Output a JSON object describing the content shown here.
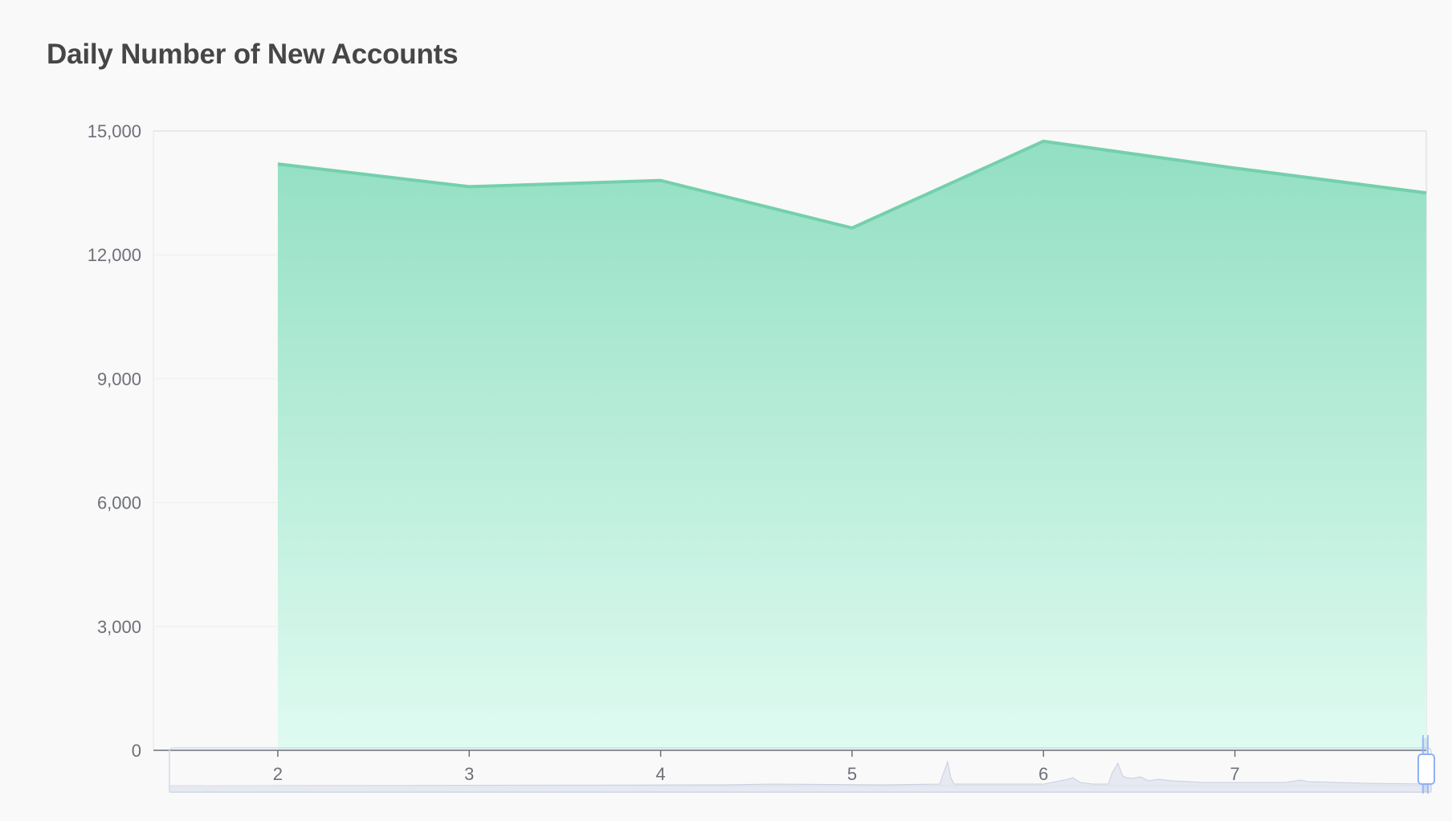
{
  "chart_data": {
    "type": "area",
    "title": "Daily Number of New Accounts",
    "xlabel": "",
    "ylabel": "",
    "x": [
      2,
      3,
      4,
      5,
      6,
      7,
      8
    ],
    "series": [
      {
        "values": [
          14200,
          13650,
          13800,
          12650,
          14750,
          14100,
          13500
        ]
      }
    ],
    "xticks": [
      "2",
      "3",
      "4",
      "5",
      "6",
      "7"
    ],
    "yticks": [
      "0",
      "3,000",
      "6,000",
      "9,000",
      "12,000",
      "15,000"
    ],
    "xlim": [
      1.35,
      8
    ],
    "ylim": [
      0,
      15000
    ],
    "grid": true,
    "legend": "none",
    "has_data_zoom_slider": true,
    "colors": {
      "line": "#74d0ac",
      "fill_top": "#92dfc3",
      "fill_bottom": "#e0fbf1",
      "axis": "#6e7079",
      "grid": "#eeeeee",
      "slider_border": "#d2dbee",
      "slider_handle": "#8fb0f7"
    }
  }
}
